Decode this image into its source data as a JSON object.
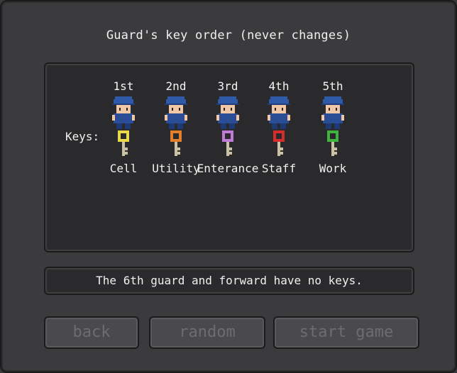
{
  "screen": {
    "title": "Guard's key order (never changes)",
    "keys_label": "Keys:",
    "message": "The 6th guard and forward have no keys."
  },
  "guards": [
    {
      "ordinal": "1st",
      "key_name": "Cell",
      "key_color": "#e8d84a"
    },
    {
      "ordinal": "2nd",
      "key_name": "Utility",
      "key_color": "#e27f2c"
    },
    {
      "ordinal": "3rd",
      "key_name": "Enterance",
      "key_color": "#c07ad8"
    },
    {
      "ordinal": "4th",
      "key_name": "Staff",
      "key_color": "#d62e2e"
    },
    {
      "ordinal": "5th",
      "key_name": "Work",
      "key_color": "#3fb43f"
    }
  ],
  "buttons": {
    "back": "back",
    "random": "random",
    "start": "start game"
  },
  "colors": {
    "guard_hat": "#2f5aa8",
    "guard_body": "#2b4d96",
    "guard_skin": "#f1c7a6"
  }
}
